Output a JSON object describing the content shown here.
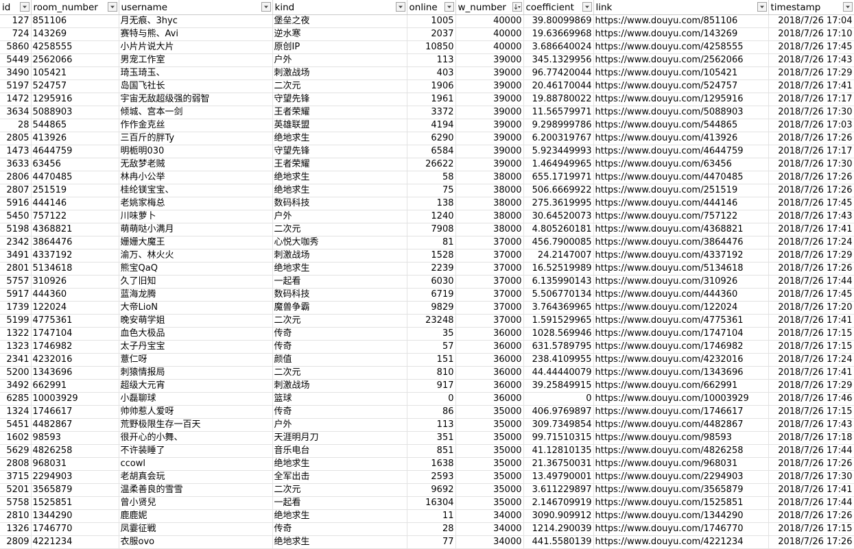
{
  "columns": [
    {
      "key": "id",
      "label": "id",
      "filter": "filter"
    },
    {
      "key": "room_number",
      "label": "room_number",
      "filter": "filter"
    },
    {
      "key": "username",
      "label": "username",
      "filter": "filter"
    },
    {
      "key": "kind",
      "label": "kind",
      "filter": "filter"
    },
    {
      "key": "online",
      "label": "online",
      "filter": "filter"
    },
    {
      "key": "w_number",
      "label": "w_number",
      "filter": "sort-desc"
    },
    {
      "key": "coefficient",
      "label": "coefficient",
      "filter": "filter"
    },
    {
      "key": "link",
      "label": "link",
      "filter": "filter"
    },
    {
      "key": "timestamp",
      "label": "timestamp",
      "filter": "filter"
    }
  ],
  "rows": [
    [
      "127",
      "851106",
      "月无痕、3hyc",
      "堡垒之夜",
      "1005",
      "40000",
      "39.80099869",
      "https://www.douyu.com/851106",
      "2018/7/26 17:04"
    ],
    [
      "724",
      "143269",
      "赛特与熊、Avi",
      "逆水寒",
      "2037",
      "40000",
      "19.63669968",
      "https://www.douyu.com/143269",
      "2018/7/26 17:10"
    ],
    [
      "5860",
      "4258555",
      "小片片说大片",
      "原创IP",
      "10850",
      "40000",
      "3.686640024",
      "https://www.douyu.com/4258555",
      "2018/7/26 17:45"
    ],
    [
      "5449",
      "2562066",
      "男宠工作室",
      "户外",
      "113",
      "39000",
      "345.1329956",
      "https://www.douyu.com/2562066",
      "2018/7/26 17:43"
    ],
    [
      "3490",
      "105421",
      "琦玉琦玉、",
      "刺激战场",
      "403",
      "39000",
      "96.77420044",
      "https://www.douyu.com/105421",
      "2018/7/26 17:29"
    ],
    [
      "5197",
      "524757",
      "岛国飞社长",
      "二次元",
      "1906",
      "39000",
      "20.46170044",
      "https://www.douyu.com/524757",
      "2018/7/26 17:41"
    ],
    [
      "1472",
      "1295916",
      "宇宙无敌超级强的弱智",
      "守望先锋",
      "1961",
      "39000",
      "19.88780022",
      "https://www.douyu.com/1295916",
      "2018/7/26 17:17"
    ],
    [
      "3634",
      "5088903",
      "倾城、宫本一剑",
      "王者荣耀",
      "3372",
      "39000",
      "11.56579971",
      "https://www.douyu.com/5088903",
      "2018/7/26 17:30"
    ],
    [
      "28",
      "544865",
      "作作金克丝",
      "英雄联盟",
      "4194",
      "39000",
      "9.298999786",
      "https://www.douyu.com/544865",
      "2018/7/26 17:03"
    ],
    [
      "2805",
      "413926",
      "三百斤的胖Ty",
      "绝地求生",
      "6290",
      "39000",
      "6.200319767",
      "https://www.douyu.com/413926",
      "2018/7/26 17:26"
    ],
    [
      "1473",
      "4644759",
      "明栀明030",
      "守望先锋",
      "6584",
      "39000",
      "5.923449993",
      "https://www.douyu.com/4644759",
      "2018/7/26 17:17"
    ],
    [
      "3633",
      "63456",
      "无敌梦老贼",
      "王者荣耀",
      "26622",
      "39000",
      "1.464949965",
      "https://www.douyu.com/63456",
      "2018/7/26 17:30"
    ],
    [
      "2806",
      "4470485",
      "林冉小公举",
      "绝地求生",
      "58",
      "38000",
      "655.1719971",
      "https://www.douyu.com/4470485",
      "2018/7/26 17:26"
    ],
    [
      "2807",
      "251519",
      "桂纶镁宝宝、",
      "绝地求生",
      "75",
      "38000",
      "506.6669922",
      "https://www.douyu.com/251519",
      "2018/7/26 17:26"
    ],
    [
      "5916",
      "444146",
      "老姚家梅总",
      "数码科技",
      "138",
      "38000",
      "275.3619995",
      "https://www.douyu.com/444146",
      "2018/7/26 17:45"
    ],
    [
      "5450",
      "757122",
      "川味萝卜",
      "户外",
      "1240",
      "38000",
      "30.64520073",
      "https://www.douyu.com/757122",
      "2018/7/26 17:43"
    ],
    [
      "5198",
      "4368821",
      "萌萌哒小满月",
      "二次元",
      "7908",
      "38000",
      "4.805260181",
      "https://www.douyu.com/4368821",
      "2018/7/26 17:41"
    ],
    [
      "2342",
      "3864476",
      "姗姗大魔王",
      "心悦大咖秀",
      "81",
      "37000",
      "456.7900085",
      "https://www.douyu.com/3864476",
      "2018/7/26 17:24"
    ],
    [
      "3491",
      "4337192",
      "渝万、林火火",
      "刺激战场",
      "1528",
      "37000",
      "24.2147007",
      "https://www.douyu.com/4337192",
      "2018/7/26 17:29"
    ],
    [
      "2801",
      "5134618",
      "熊宝QaQ",
      "绝地求生",
      "2239",
      "37000",
      "16.52519989",
      "https://www.douyu.com/5134618",
      "2018/7/26 17:26"
    ],
    [
      "5757",
      "310926",
      "久了旧知",
      "一起看",
      "6030",
      "37000",
      "6.135990143",
      "https://www.douyu.com/310926",
      "2018/7/26 17:44"
    ],
    [
      "5917",
      "444360",
      "蓝海龙腾",
      "数码科技",
      "6719",
      "37000",
      "5.506770134",
      "https://www.douyu.com/444360",
      "2018/7/26 17:45"
    ],
    [
      "1739",
      "122024",
      "大帝LioN",
      "魔兽争霸",
      "9829",
      "37000",
      "3.764369965",
      "https://www.douyu.com/122024",
      "2018/7/26 17:20"
    ],
    [
      "5199",
      "4775361",
      "晚安萌学姐",
      "二次元",
      "23248",
      "37000",
      "1.591529965",
      "https://www.douyu.com/4775361",
      "2018/7/26 17:41"
    ],
    [
      "1322",
      "1747104",
      "血色大极品",
      "传奇",
      "35",
      "36000",
      "1028.569946",
      "https://www.douyu.com/1747104",
      "2018/7/26 17:15"
    ],
    [
      "1323",
      "1746982",
      "太子丹宝宝",
      "传奇",
      "57",
      "36000",
      "631.5789795",
      "https://www.douyu.com/1746982",
      "2018/7/26 17:15"
    ],
    [
      "2341",
      "4232016",
      "薏仁呀",
      "颜值",
      "151",
      "36000",
      "238.4109955",
      "https://www.douyu.com/4232016",
      "2018/7/26 17:24"
    ],
    [
      "5200",
      "1343696",
      "刺猿情报局",
      "二次元",
      "810",
      "36000",
      "44.44440079",
      "https://www.douyu.com/1343696",
      "2018/7/26 17:41"
    ],
    [
      "3492",
      "662991",
      "超级大元宵",
      "刺激战场",
      "917",
      "36000",
      "39.25849915",
      "https://www.douyu.com/662991",
      "2018/7/26 17:29"
    ],
    [
      "6285",
      "10003929",
      "小磊聊球",
      "篮球",
      "0",
      "36000",
      "0",
      "https://www.douyu.com/10003929",
      "2018/7/26 17:46"
    ],
    [
      "1324",
      "1746617",
      "帅帅惹人爱呀",
      "传奇",
      "86",
      "35000",
      "406.9769897",
      "https://www.douyu.com/1746617",
      "2018/7/26 17:15"
    ],
    [
      "5451",
      "4482867",
      "荒野极限生存一百天",
      "户外",
      "113",
      "35000",
      "309.7349854",
      "https://www.douyu.com/4482867",
      "2018/7/26 17:43"
    ],
    [
      "1602",
      "98593",
      "很开心的小舞、",
      "天涯明月刀",
      "351",
      "35000",
      "99.71510315",
      "https://www.douyu.com/98593",
      "2018/7/26 17:18"
    ],
    [
      "5629",
      "4826258",
      "不许装睡了",
      "音乐电台",
      "851",
      "35000",
      "41.12810135",
      "https://www.douyu.com/4826258",
      "2018/7/26 17:44"
    ],
    [
      "2808",
      "968031",
      "ccowl",
      "绝地求生",
      "1638",
      "35000",
      "21.36750031",
      "https://www.douyu.com/968031",
      "2018/7/26 17:26"
    ],
    [
      "3715",
      "2294903",
      "老胡真会玩",
      "全军出击",
      "2593",
      "35000",
      "13.49790001",
      "https://www.douyu.com/2294903",
      "2018/7/26 17:30"
    ],
    [
      "5201",
      "3565879",
      "温柔善良的雪雪",
      "二次元",
      "9692",
      "35000",
      "3.611229897",
      "https://www.douyu.com/3565879",
      "2018/7/26 17:41"
    ],
    [
      "5758",
      "1525851",
      "曾小贤兒",
      "一起看",
      "16304",
      "35000",
      "2.146709919",
      "https://www.douyu.com/1525851",
      "2018/7/26 17:44"
    ],
    [
      "2810",
      "1344290",
      "鹿鹿妮",
      "绝地求生",
      "11",
      "34000",
      "3090.909912",
      "https://www.douyu.com/1344290",
      "2018/7/26 17:26"
    ],
    [
      "1326",
      "1746770",
      "凤霎征戦",
      "传奇",
      "28",
      "34000",
      "1214.290039",
      "https://www.douyu.com/1746770",
      "2018/7/26 17:15"
    ],
    [
      "2809",
      "4221234",
      "衣服ovo",
      "绝地求生",
      "77",
      "34000",
      "441.5580139",
      "https://www.douyu.com/4221234",
      "2018/7/26 17:26"
    ]
  ]
}
